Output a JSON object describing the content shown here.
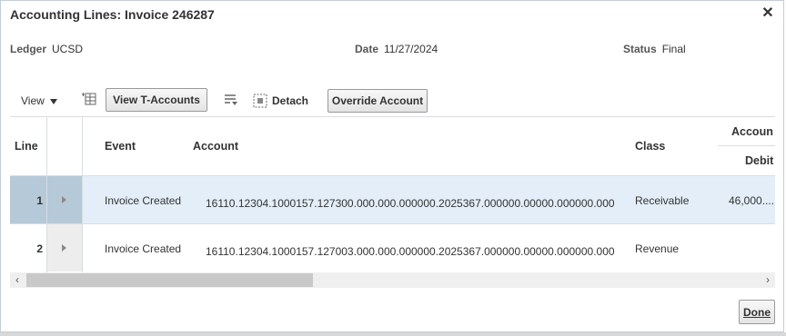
{
  "dialog": {
    "title": "Accounting Lines: Invoice 246287",
    "close_icon": "close-icon"
  },
  "header": {
    "ledger_label": "Ledger",
    "ledger_value": "UCSD",
    "date_label": "Date",
    "date_value": "11/27/2024",
    "status_label": "Status",
    "status_value": "Final"
  },
  "toolbar": {
    "view_label": "View",
    "freeze_icon": "freeze-columns-icon",
    "t_accounts_label": "View T-Accounts",
    "wrap_icon": "wrap-icon",
    "detach_icon": "detach-icon",
    "detach_label": "Detach",
    "override_label": "Override Account"
  },
  "table": {
    "columns": {
      "line": "Line",
      "event": "Event",
      "account": "Account",
      "class": "Class",
      "accounted_group": "Accoun",
      "debit": "Debit"
    },
    "rows": [
      {
        "line": "1",
        "event": "Invoice Created",
        "account": "16110.12304.1000157.127300.000.000.000000.2025367.000000.00000.000000.000",
        "class": "Receivable",
        "debit": "46,000...."
      },
      {
        "line": "2",
        "event": "Invoice Created",
        "account": "16110.12304.1000157.127003.000.000.000000.2025367.000000.00000.000000.000",
        "class": "Revenue",
        "debit": ""
      }
    ]
  },
  "footer": {
    "done_label": "Done"
  },
  "colors": {
    "selected_row": "#e3eef9",
    "selected_header": "#b6c9d9",
    "border": "#d9dde2"
  }
}
